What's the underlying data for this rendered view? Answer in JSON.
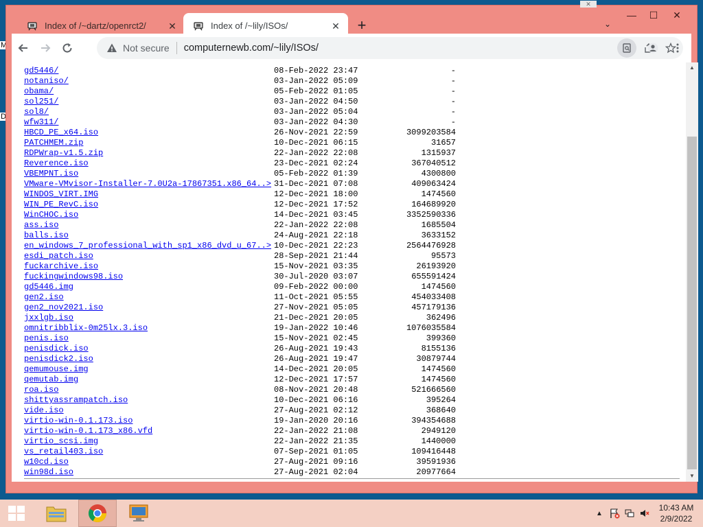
{
  "desktop": {
    "letters": [
      "M",
      "D"
    ]
  },
  "browser": {
    "tabs": [
      {
        "title": "Index of /~dartz/openrct2/",
        "active": false
      },
      {
        "title": "Index of /~lily/ISOs/",
        "active": true
      }
    ],
    "new_tab_symbol": "+",
    "tab_search_symbol": "⌄",
    "window_buttons": {
      "minimize": "—",
      "maximize": "☐",
      "close": "✕"
    },
    "address": {
      "security_label": "Not secure",
      "url": "computernewb.com/~lily/ISOs/"
    }
  },
  "listing": {
    "rows": [
      {
        "name": "gd5446/",
        "date": "08-Feb-2022 23:47",
        "size": "-"
      },
      {
        "name": "notaniso/",
        "date": "03-Jan-2022 05:09",
        "size": "-"
      },
      {
        "name": "obama/",
        "date": "05-Feb-2022 01:05",
        "size": "-"
      },
      {
        "name": "sol251/",
        "date": "03-Jan-2022 04:50",
        "size": "-"
      },
      {
        "name": "sol8/",
        "date": "03-Jan-2022 05:04",
        "size": "-"
      },
      {
        "name": "wfw311/",
        "date": "03-Jan-2022 04:30",
        "size": "-"
      },
      {
        "name": "HBCD_PE_x64.iso",
        "date": "26-Nov-2021 22:59",
        "size": "3099203584"
      },
      {
        "name": "PATCHMEM.zip",
        "date": "10-Dec-2021 06:15",
        "size": "31657"
      },
      {
        "name": "RDPWrap-v1.5.zip",
        "date": "22-Jan-2022 22:08",
        "size": "1315937"
      },
      {
        "name": "Reverence.iso",
        "date": "23-Dec-2021 02:24",
        "size": "367040512"
      },
      {
        "name": "VBEMPNT.iso",
        "date": "05-Feb-2022 01:39",
        "size": "4300800"
      },
      {
        "name": "VMware-VMvisor-Installer-7.0U2a-17867351.x86_64..>",
        "date": "31-Dec-2021 07:08",
        "size": "409063424"
      },
      {
        "name": "WINDOS_VIRT.IMG",
        "date": "12-Dec-2021 18:00",
        "size": "1474560"
      },
      {
        "name": "WIN_PE_RevC.iso",
        "date": "12-Dec-2021 17:52",
        "size": "164689920"
      },
      {
        "name": "WinCHOC.iso",
        "date": "14-Dec-2021 03:45",
        "size": "3352590336"
      },
      {
        "name": "ass.iso",
        "date": "22-Jan-2022 22:08",
        "size": "1685504"
      },
      {
        "name": "balls.iso",
        "date": "24-Aug-2021 22:18",
        "size": "3633152"
      },
      {
        "name": "en_windows_7_professional_with_sp1_x86_dvd_u_67..>",
        "date": "10-Dec-2021 22:23",
        "size": "2564476928"
      },
      {
        "name": "esdi_patch.iso",
        "date": "28-Sep-2021 21:44",
        "size": "95573"
      },
      {
        "name": "fuckarchive.iso",
        "date": "15-Nov-2021 03:35",
        "size": "26193920"
      },
      {
        "name": "fuckingwindows98.iso",
        "date": "30-Jul-2020 03:07",
        "size": "655591424"
      },
      {
        "name": "gd5446.img",
        "date": "09-Feb-2022 00:00",
        "size": "1474560"
      },
      {
        "name": "gen2.iso",
        "date": "11-Oct-2021 05:55",
        "size": "454033408"
      },
      {
        "name": "gen2_nov2021.iso",
        "date": "27-Nov-2021 05:05",
        "size": "457179136"
      },
      {
        "name": "jxxlgb.iso",
        "date": "21-Dec-2021 20:05",
        "size": "362496"
      },
      {
        "name": "omnitribblix-0m25lx.3.iso",
        "date": "19-Jan-2022 10:46",
        "size": "1076035584"
      },
      {
        "name": "penis.iso",
        "date": "15-Nov-2021 02:45",
        "size": "399360"
      },
      {
        "name": "penisdick.iso",
        "date": "26-Aug-2021 19:43",
        "size": "8155136"
      },
      {
        "name": "penisdick2.iso",
        "date": "26-Aug-2021 19:47",
        "size": "30879744"
      },
      {
        "name": "qemumouse.img",
        "date": "14-Dec-2021 20:05",
        "size": "1474560"
      },
      {
        "name": "qemutab.img",
        "date": "12-Dec-2021 17:57",
        "size": "1474560"
      },
      {
        "name": "roa.iso",
        "date": "08-Nov-2021 20:48",
        "size": "521666560"
      },
      {
        "name": "shittyassrampatch.iso",
        "date": "10-Dec-2021 06:16",
        "size": "395264"
      },
      {
        "name": "vide.iso",
        "date": "27-Aug-2021 02:12",
        "size": "368640"
      },
      {
        "name": "virtio-win-0.1.173.iso",
        "date": "19-Jan-2020 20:16",
        "size": "394354688"
      },
      {
        "name": "virtio-win-0.1.173_x86.vfd",
        "date": "22-Jan-2022 21:08",
        "size": "2949120"
      },
      {
        "name": "virtio_scsi.img",
        "date": "22-Jan-2022 21:35",
        "size": "1440000"
      },
      {
        "name": "vs_retail403.iso",
        "date": "07-Sep-2021 01:05",
        "size": "109416448"
      },
      {
        "name": "w10cd.iso",
        "date": "27-Aug-2021 09:16",
        "size": "39591936"
      },
      {
        "name": "win98d.iso",
        "date": "27-Aug-2021 02:04",
        "size": "20977664"
      }
    ]
  },
  "taskbar": {
    "clock_time": "10:43 AM",
    "clock_date": "2/9/2022",
    "tray_up_symbol": "▲"
  },
  "colors": {
    "window_frame": "#f08c84",
    "taskbar": "#f4d0c4",
    "link": "#0000ee"
  }
}
